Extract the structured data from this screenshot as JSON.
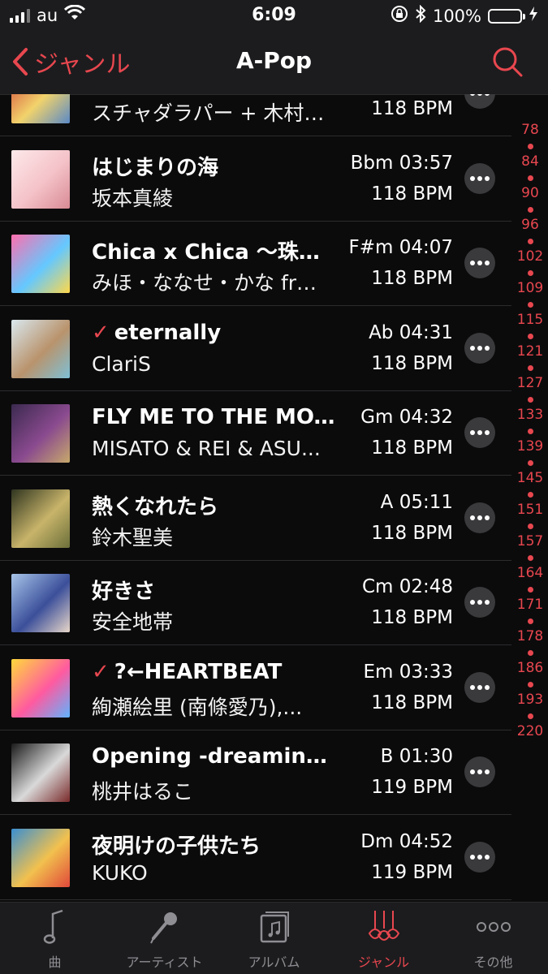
{
  "status_bar": {
    "carrier": "au",
    "time": "6:09",
    "battery": "100%",
    "battery_color": "#4cd964"
  },
  "nav": {
    "back_label": "ジャンル",
    "title": "A-Pop",
    "accent": "#e8474f"
  },
  "rows": [
    {
      "title": "",
      "artist": "スチャダラパー + 木村…",
      "key_time": "",
      "bpm": "118 BPM",
      "checked": false,
      "colors": [
        "#c33",
        "#f2d36b",
        "#5a89c6"
      ]
    },
    {
      "title": "はじまりの海",
      "artist": "坂本真綾",
      "key_time": "Bbm 03:57",
      "bpm": "118 BPM",
      "checked": false,
      "colors": [
        "#fde9ea",
        "#f4c2c8",
        "#d88a94"
      ]
    },
    {
      "title": "Chica x Chica 〜珠…",
      "artist": "みほ・ななせ・かな fr…",
      "key_time": "F#m 04:07",
      "bpm": "118 BPM",
      "checked": false,
      "colors": [
        "#ff6fae",
        "#64c8ff",
        "#ffd84a"
      ]
    },
    {
      "title": "eternally",
      "artist": "ClariS",
      "key_time": "Ab 04:31",
      "bpm": "118 BPM",
      "checked": true,
      "colors": [
        "#d9e8ef",
        "#b9936c",
        "#7ec0d6"
      ]
    },
    {
      "title": "FLY ME TO THE MO...",
      "artist": "MISATO & REI & ASU...",
      "key_time": "Gm 04:32",
      "bpm": "118 BPM",
      "checked": false,
      "colors": [
        "#3b2a4f",
        "#8a4a8f",
        "#c7a96b"
      ]
    },
    {
      "title": "熱くなれたら",
      "artist": "鈴木聖美",
      "key_time": "A 05:11",
      "bpm": "118 BPM",
      "checked": false,
      "colors": [
        "#2f3520",
        "#c8b46a",
        "#6b6f3a"
      ]
    },
    {
      "title": "好きさ",
      "artist": "安全地帯",
      "key_time": "Cm 02:48",
      "bpm": "118 BPM",
      "checked": false,
      "colors": [
        "#a7c4e8",
        "#3b4f9a",
        "#e8d7c9"
      ]
    },
    {
      "title": "?←HEARTBEAT",
      "artist": "絢瀬絵里 (南條愛乃),...",
      "key_time": "Em 03:33",
      "bpm": "118 BPM",
      "checked": true,
      "colors": [
        "#ffd93b",
        "#ff5aa0",
        "#5fb3ff"
      ]
    },
    {
      "title": "Opening -dreaming m...",
      "artist": "桃井はるこ",
      "key_time": "B 01:30",
      "bpm": "119 BPM",
      "checked": false,
      "colors": [
        "#1a1a1a",
        "#d9d9d9",
        "#7a2a2a"
      ]
    },
    {
      "title": "夜明けの子供たち",
      "artist": "KUKO",
      "key_time": "Dm 04:52",
      "bpm": "119 BPM",
      "checked": false,
      "colors": [
        "#3a8fd1",
        "#f2c14e",
        "#e0483a"
      ]
    }
  ],
  "index": [
    "78",
    "84",
    "90",
    "96",
    "102",
    "109",
    "115",
    "121",
    "127",
    "133",
    "139",
    "145",
    "151",
    "157",
    "164",
    "171",
    "178",
    "186",
    "193",
    "220"
  ],
  "tabs": [
    {
      "label": "曲",
      "icon": "music-note-icon",
      "active": false
    },
    {
      "label": "アーティスト",
      "icon": "microphone-icon",
      "active": false
    },
    {
      "label": "アルバム",
      "icon": "album-icon",
      "active": false
    },
    {
      "label": "ジャンル",
      "icon": "guitars-icon",
      "active": true
    },
    {
      "label": "その他",
      "icon": "more-icon",
      "active": false
    }
  ]
}
